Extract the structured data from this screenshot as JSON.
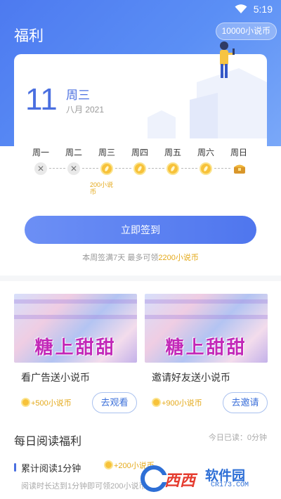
{
  "status_bar": {
    "time": "5:19"
  },
  "header": {
    "title": "福利",
    "coin_balance": "10000小说币"
  },
  "checkin": {
    "date_day": "11",
    "weekday": "周三",
    "month_year": "八月 2021",
    "days": [
      "周一",
      "周二",
      "周三",
      "周四",
      "周五",
      "周六",
      "周日"
    ],
    "missed_mark": "✕",
    "bonus_label": "200小说币",
    "button_label": "立即签到",
    "hint_prefix": "本周签满7天 最多可领",
    "hint_amount": "2200小说币"
  },
  "tasks": [
    {
      "image_text": "糖上甜甜",
      "title": "看广告送小说币",
      "reward": "+500小说币",
      "button": "去观看"
    },
    {
      "image_text": "糖上甜甜",
      "title": "邀请好友送小说币",
      "reward": "+900小说币",
      "button": "去邀请"
    }
  ],
  "daily": {
    "title": "每日阅读福利",
    "today": "今日已读：0分钟",
    "task_title": "累计阅读1分钟",
    "task_reward": "+200小说币",
    "task_desc": "阅读时长达到1分钟即可领200小说币"
  },
  "watermark": {
    "brand_a": "西西",
    "brand_b": "软件园",
    "domain": "CR173.COM"
  },
  "colors": {
    "primary": "#4f76ee",
    "coin": "#e4a91a",
    "watermark_red": "#e53c2f",
    "watermark_blue": "#2e6fd6"
  }
}
